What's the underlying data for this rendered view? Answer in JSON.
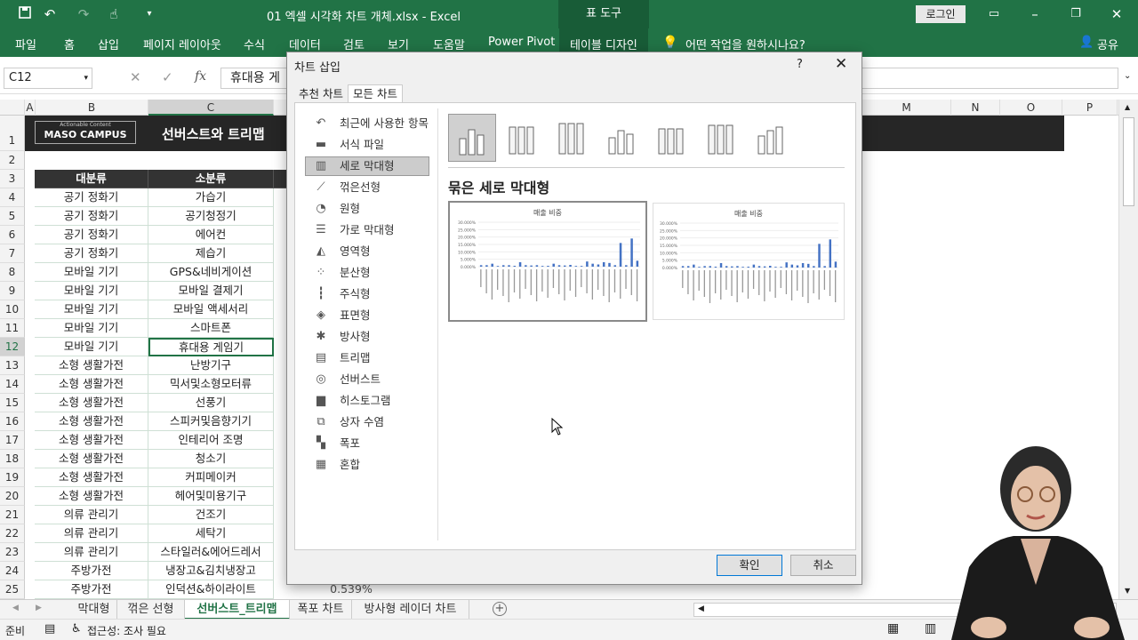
{
  "window": {
    "title": "01 엑셀 시각화 차트 개체.xlsx  -  Excel",
    "context_tab": "표 도구",
    "login_button": "로그인"
  },
  "ribbon": {
    "tabs": [
      "파일",
      "홈",
      "삽입",
      "페이지 레이아웃",
      "수식",
      "데이터",
      "검토",
      "보기",
      "도움말",
      "Power Pivot",
      "테이블 디자인"
    ],
    "tell_me": "어떤 작업을 원하시나요?",
    "share": "공유"
  },
  "formula_bar": {
    "name_box": "C12",
    "content": "휴대용 게",
    "fx": "fx"
  },
  "columns": [
    "A",
    "B",
    "C",
    "M",
    "N",
    "O",
    "P"
  ],
  "banner": {
    "logo_top": "Actionable Content",
    "logo": "MASO CAMPUS",
    "title": "선버스트와 트리맵"
  },
  "table": {
    "headers": [
      "대분류",
      "소분류"
    ],
    "rows": [
      {
        "r": "4",
        "a": "공기 정화기",
        "b": "가습기"
      },
      {
        "r": "5",
        "a": "공기 정화기",
        "b": "공기청정기"
      },
      {
        "r": "6",
        "a": "공기 정화기",
        "b": "에어컨"
      },
      {
        "r": "7",
        "a": "공기 정화기",
        "b": "제습기"
      },
      {
        "r": "8",
        "a": "모바일 기기",
        "b": "GPS&네비게이션"
      },
      {
        "r": "9",
        "a": "모바일 기기",
        "b": "모바일 결제기"
      },
      {
        "r": "10",
        "a": "모바일 기기",
        "b": "모바일 액세서리"
      },
      {
        "r": "11",
        "a": "모바일 기기",
        "b": "스마트폰"
      },
      {
        "r": "12",
        "a": "모바일 기기",
        "b": "휴대용 게임기"
      },
      {
        "r": "13",
        "a": "소형 생활가전",
        "b": "난방기구"
      },
      {
        "r": "14",
        "a": "소형 생활가전",
        "b": "믹서및소형모터류"
      },
      {
        "r": "15",
        "a": "소형 생활가전",
        "b": "선풍기"
      },
      {
        "r": "16",
        "a": "소형 생활가전",
        "b": "스피커및음향기기"
      },
      {
        "r": "17",
        "a": "소형 생활가전",
        "b": "인테리어 조명"
      },
      {
        "r": "18",
        "a": "소형 생활가전",
        "b": "청소기"
      },
      {
        "r": "19",
        "a": "소형 생활가전",
        "b": "커피메이커"
      },
      {
        "r": "20",
        "a": "소형 생활가전",
        "b": "헤어및미용기구"
      },
      {
        "r": "21",
        "a": "의류 관리기",
        "b": "건조기"
      },
      {
        "r": "22",
        "a": "의류 관리기",
        "b": "세탁기"
      },
      {
        "r": "23",
        "a": "의류 관리기",
        "b": "스타일러&에어드레서"
      },
      {
        "r": "24",
        "a": "주방가전",
        "b": "냉장고&김치냉장고"
      },
      {
        "r": "25",
        "a": "주방가전",
        "b": "인덕션&하이라이트",
        "c": "0.539%"
      }
    ]
  },
  "dialog": {
    "title": "차트 삽입",
    "help": "?",
    "tabs": [
      "추천 차트",
      "모든 차트"
    ],
    "nav": [
      "최근에 사용한 항목",
      "서식 파일",
      "세로 막대형",
      "꺾은선형",
      "원형",
      "가로 막대형",
      "영역형",
      "분산형",
      "주식형",
      "표면형",
      "방사형",
      "트리맵",
      "선버스트",
      "히스토그램",
      "상자 수염",
      "폭포",
      "혼합"
    ],
    "nav_icons": [
      "undo-icon",
      "folder-icon",
      "column-chart-icon",
      "line-chart-icon",
      "pie-chart-icon",
      "bar-chart-icon",
      "area-chart-icon",
      "scatter-chart-icon",
      "stock-chart-icon",
      "surface-chart-icon",
      "radar-chart-icon",
      "treemap-icon",
      "sunburst-icon",
      "histogram-icon",
      "box-whisker-icon",
      "waterfall-icon",
      "combo-chart-icon"
    ],
    "subtype_title": "묶은 세로 막대형",
    "preview_title": "매출 비중",
    "ok": "확인",
    "cancel": "취소"
  },
  "chart_data": [
    {
      "type": "bar",
      "title": "매출 비중",
      "ylim": [
        0,
        0.3
      ],
      "ytick_labels": [
        "30.000%",
        "25.000%",
        "20.000%",
        "15.000%",
        "10.000%",
        "5.000%",
        "0.000%"
      ]
    },
    {
      "type": "bar",
      "title": "매출 비중",
      "ylim": [
        0,
        0.3
      ],
      "ytick_labels": [
        "30.000%",
        "25.000%",
        "20.000%",
        "15.000%",
        "10.000%",
        "5.000%",
        "0.000%"
      ]
    }
  ],
  "sheet_tabs": [
    "막대형",
    "꺾은 선형",
    "선버스트_트리맵",
    "폭포 차트",
    "방사형 레이더 차트"
  ],
  "status": {
    "ready": "준비",
    "accessibility": "접근성: 조사 필요"
  },
  "colors": {
    "excel_green": "#217346",
    "dark_banner": "#262626",
    "header_fill": "#333333",
    "bar_blue": "#4472c4",
    "selected_nav": "#cccccc"
  }
}
